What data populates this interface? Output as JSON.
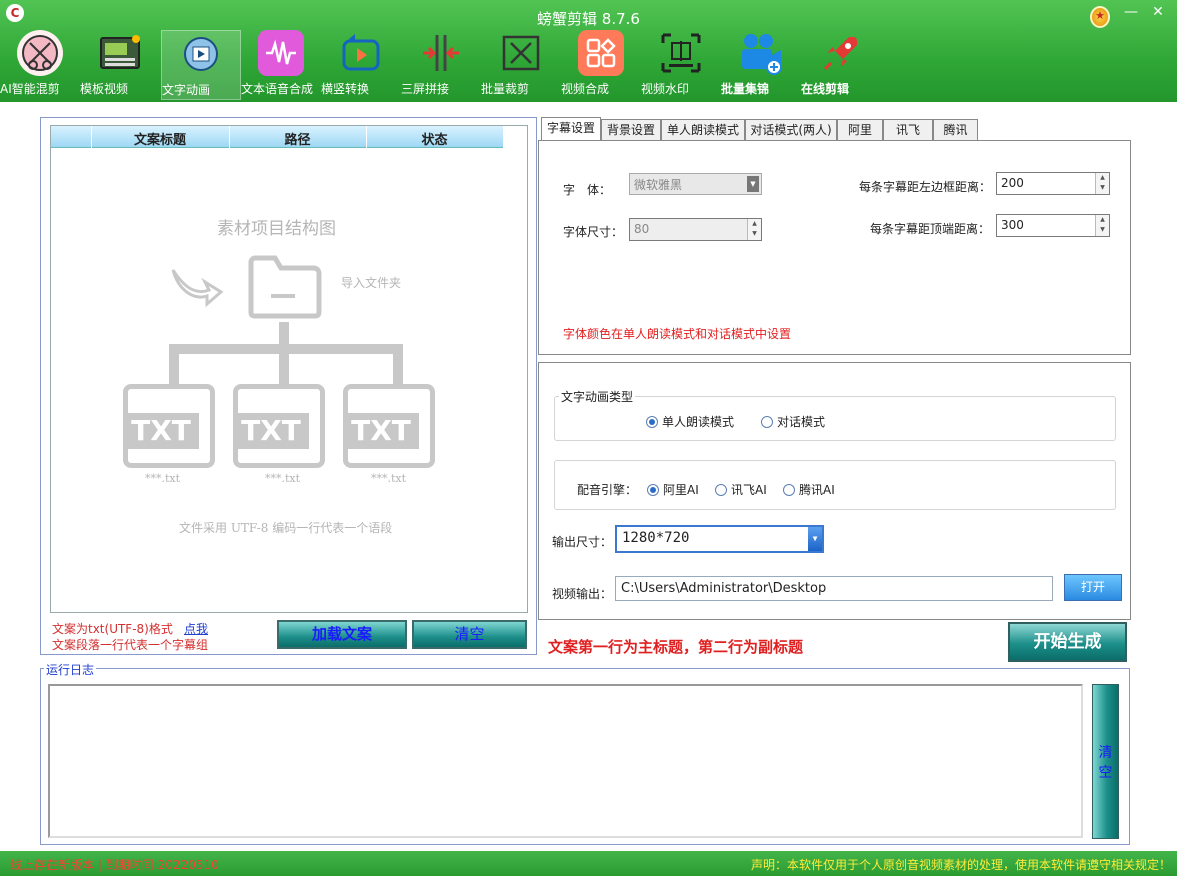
{
  "window": {
    "title": "螃蟹剪辑 8.7.6",
    "minimize": "—",
    "close": "✕"
  },
  "toolbar": [
    {
      "label": "AI智能混剪",
      "icon": "ai-mix-icon"
    },
    {
      "label": "模板视频",
      "icon": "template-video-icon"
    },
    {
      "label": "文字动画",
      "icon": "text-animation-icon",
      "active": true
    },
    {
      "label": "文本语音合成",
      "icon": "tts-icon"
    },
    {
      "label": "横竖转换",
      "icon": "rotate-icon"
    },
    {
      "label": "三屏拼接",
      "icon": "three-screen-icon"
    },
    {
      "label": "批量裁剪",
      "icon": "crop-icon"
    },
    {
      "label": "视频合成",
      "icon": "video-merge-icon"
    },
    {
      "label": "视频水印",
      "icon": "watermark-icon"
    },
    {
      "label": "批量集锦",
      "icon": "highlight-camera-icon"
    },
    {
      "label": "在线剪辑",
      "icon": "rocket-icon"
    }
  ],
  "grid": {
    "columns": [
      "文案标题",
      "路径",
      "状态"
    ],
    "placeholder_title": "素材项目结构图",
    "import_folder": "导入文件夹",
    "file_badge": "TXT",
    "file_ext": "***.txt",
    "encoding_note": "文件采用 UTF-8 编码一行代表一个语段"
  },
  "left_notes": {
    "line1": "文案为txt(UTF-8)格式",
    "link": "点我",
    "line2": "文案段落一行代表一个字幕组"
  },
  "left_buttons": {
    "load": "加载文案",
    "clear": "清空"
  },
  "tabs": [
    "字幕设置",
    "背景设置",
    "单人朗读模式",
    "对话模式(两人)",
    "阿里",
    "讯飞",
    "腾讯"
  ],
  "subtitle": {
    "font_label": "字　体：",
    "font_value": "微软雅黑",
    "size_label": "字体尺寸：",
    "size_value": "80",
    "left_margin_label": "每条字幕距左边框距离：",
    "left_margin_value": "200",
    "top_margin_label": "每条字幕距顶端距离：",
    "top_margin_value": "300",
    "color_note": "字体颜色在单人朗读模式和对话模式中设置"
  },
  "anim": {
    "group_title": "文字动画类型",
    "mode_single": "单人朗读模式",
    "mode_dialog": "对话模式",
    "voice_label": "配音引擎：",
    "voice_ali": "阿里AI",
    "voice_xunfei": "讯飞AI",
    "voice_tencent": "腾讯AI",
    "size_label": "输出尺寸：",
    "size_value": "1280*720",
    "output_label": "视频输出：",
    "output_value": "C:\\Users\\Administrator\\Desktop",
    "open_button": "打开"
  },
  "hint": "文案第一行为主标题，第二行为副标题",
  "start_button": "开始生成",
  "log": {
    "title": "运行日志",
    "clear": "清空"
  },
  "status": {
    "left": "线上存在新版本 | 到期时间:20220510",
    "right": "声明：本软件仅用于个人原创音视频素材的处理，使用本软件请遵守相关规定！"
  }
}
